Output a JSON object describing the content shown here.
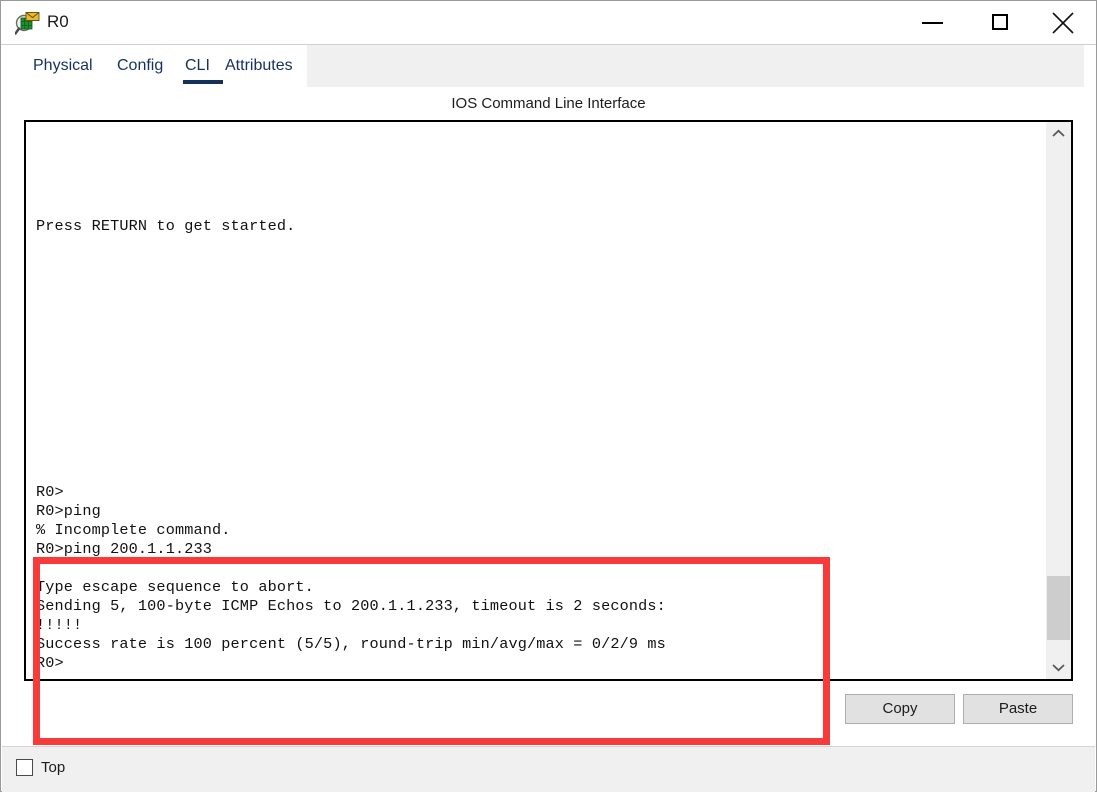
{
  "window": {
    "title": "R0",
    "icon": "router-magnifier-icon",
    "controls": {
      "minimize": "minimize-button",
      "maximize": "maximize-button",
      "close": "close-button"
    }
  },
  "tabs": [
    {
      "label": "Physical",
      "active": false
    },
    {
      "label": "Config",
      "active": false
    },
    {
      "label": "CLI",
      "active": true
    },
    {
      "label": "Attributes",
      "active": false
    }
  ],
  "main": {
    "cli_header": "IOS Command Line Interface",
    "terminal_text": "\n\n\n\nPress RETURN to get started.\n\n\n\n\n\n\n\n\n\n\n\n\n\nR0>\nR0>ping\n% Incomplete command.\nR0>ping 200.1.1.233\n\nType escape sequence to abort.\nSending 5, 100-byte ICMP Echos to 200.1.1.233, timeout is 2 seconds:\n!!!!!\nSuccess rate is 100 percent (5/5), round-trip min/avg/max = 0/2/9 ms\nR0>",
    "highlight_color": "#f93a3a",
    "scrollbar": {
      "up_arrow": "scroll-up-icon",
      "down_arrow": "scroll-down-icon",
      "thumb_top_pct": 81.5,
      "thumb_height_pct": 11.5
    }
  },
  "buttons": {
    "copy": "Copy",
    "paste": "Paste"
  },
  "footer": {
    "top_checkbox_label": "Top",
    "top_checkbox_checked": false
  }
}
